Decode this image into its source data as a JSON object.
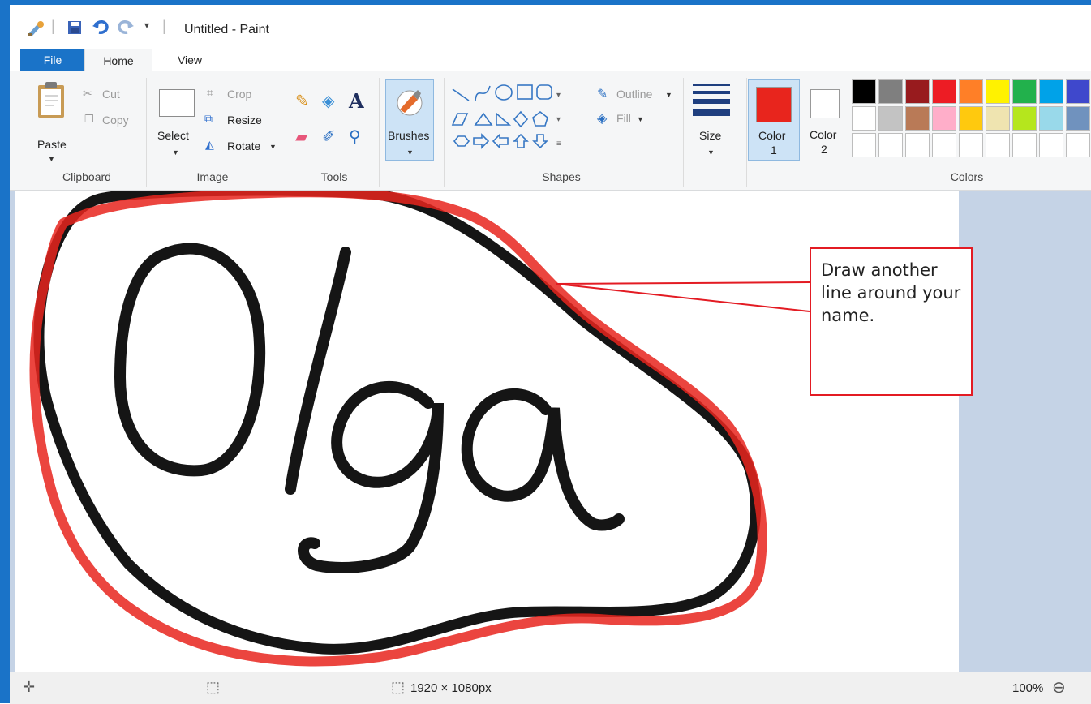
{
  "window": {
    "title": "Untitled - Paint"
  },
  "tabs": {
    "file": "File",
    "home": "Home",
    "view": "View"
  },
  "ribbon": {
    "clipboard": {
      "paste": "Paste",
      "cut": "Cut",
      "copy": "Copy",
      "label": "Clipboard"
    },
    "image": {
      "select": "Select",
      "crop": "Crop",
      "resize": "Resize",
      "rotate": "Rotate",
      "label": "Image"
    },
    "tools": {
      "label": "Tools"
    },
    "brushes": {
      "label": "Brushes"
    },
    "shapes": {
      "outline": "Outline",
      "fill": "Fill",
      "label": "Shapes"
    },
    "size": {
      "label": "Size"
    },
    "colors": {
      "color1_a": "Color",
      "color1_b": "1",
      "color2_a": "Color",
      "color2_b": "2",
      "label": "Colors",
      "color1_value": "#e8251d",
      "color2_value": "#ffffff",
      "palette_row1": [
        "#000000",
        "#7f7f7f",
        "#981b1e",
        "#ed1c24",
        "#ff7f27",
        "#fff200",
        "#22b14c",
        "#00a2e8",
        "#3f48cc"
      ],
      "palette_row2": [
        "#ffffff",
        "#c3c3c3",
        "#b97a57",
        "#ffaec9",
        "#ffc90e",
        "#efe4b0",
        "#b5e61d",
        "#99d9ea",
        "#7092be"
      ]
    }
  },
  "canvas": {
    "text": "Olga"
  },
  "callout": {
    "text": "Draw another line around your name."
  },
  "status": {
    "dimensions": "1920 × 1080px",
    "zoom": "100%"
  }
}
